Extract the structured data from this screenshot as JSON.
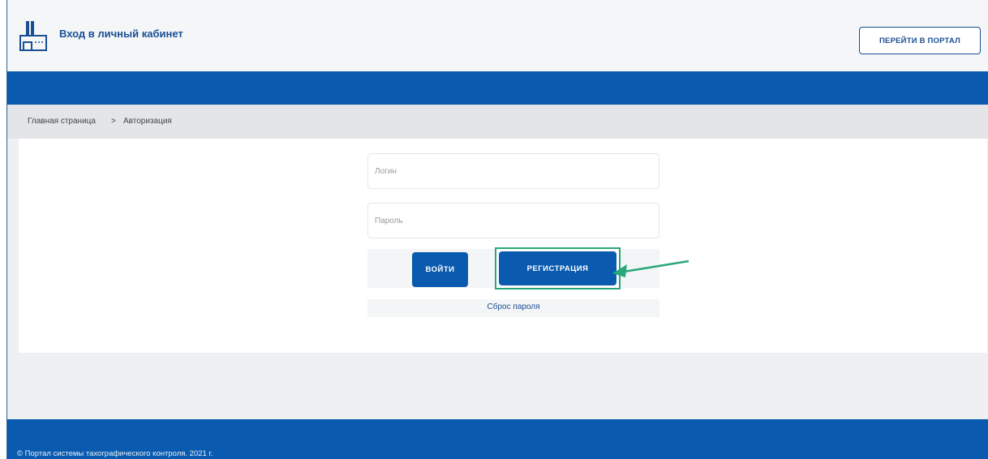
{
  "header": {
    "title": "Вход в личный кабинет",
    "portal_button": "ПЕРЕЙТИ В ПОРТАЛ",
    "logo_icon": "factory-icon"
  },
  "breadcrumb": {
    "home": "Главная страница",
    "separator": ">",
    "current": "Авторизация"
  },
  "form": {
    "login_placeholder": "Логин",
    "password_placeholder": "Пароль",
    "login_button": "ВОЙТИ",
    "register_button": "РЕГИСТРАЦИЯ",
    "reset_link": "Сброс пароля"
  },
  "annotation": {
    "arrow_color": "#28a77a"
  },
  "footer": {
    "copyright": "© Портал системы тахографического контроля. 2021 г."
  },
  "colors": {
    "primary": "#0a5bb0",
    "accent_highlight": "#28a77a",
    "text_link": "#1a4f93"
  }
}
